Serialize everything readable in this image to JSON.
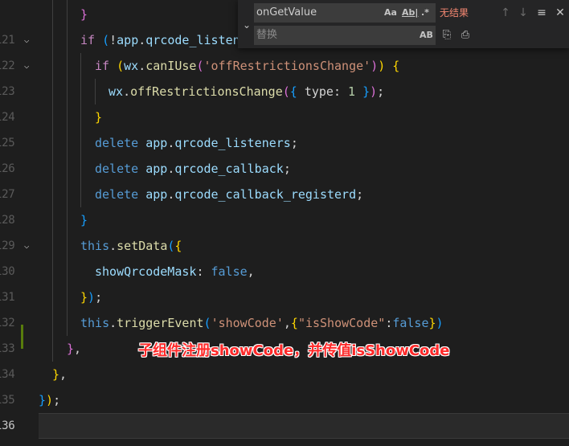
{
  "editor": {
    "lines": [
      {
        "num": "",
        "fold": false,
        "indent": 100,
        "tokens": [
          {
            "t": "}",
            "c": "b2"
          }
        ]
      },
      {
        "num": "121",
        "fold": true,
        "indent": 100,
        "tokens": [
          {
            "t": "if",
            "c": "ctl"
          },
          {
            "t": " ",
            "c": "pl"
          },
          {
            "t": "(",
            "c": "b3"
          },
          {
            "t": "!",
            "c": "pl"
          },
          {
            "t": "app",
            "c": "prop"
          },
          {
            "t": ".",
            "c": "pl"
          },
          {
            "t": "qrcode_listeners",
            "c": "prop"
          }
        ]
      },
      {
        "num": "122",
        "fold": true,
        "indent": 118,
        "tokens": [
          {
            "t": "if",
            "c": "ctl"
          },
          {
            "t": " ",
            "c": "pl"
          },
          {
            "t": "(",
            "c": "b1"
          },
          {
            "t": "wx",
            "c": "prop"
          },
          {
            "t": ".",
            "c": "pl"
          },
          {
            "t": "canIUse",
            "c": "fn"
          },
          {
            "t": "(",
            "c": "b2"
          },
          {
            "t": "'offRestrictionsChange'",
            "c": "str"
          },
          {
            "t": ")",
            "c": "b2"
          },
          {
            "t": ")",
            "c": "b1"
          },
          {
            "t": " ",
            "c": "pl"
          },
          {
            "t": "{",
            "c": "b1"
          }
        ]
      },
      {
        "num": "123",
        "fold": false,
        "indent": 135,
        "tokens": [
          {
            "t": "wx",
            "c": "prop"
          },
          {
            "t": ".",
            "c": "pl"
          },
          {
            "t": "offRestrictionsChange",
            "c": "fn"
          },
          {
            "t": "(",
            "c": "b2"
          },
          {
            "t": "{",
            "c": "b3"
          },
          {
            "t": " type: ",
            "c": "pl"
          },
          {
            "t": "1",
            "c": "num"
          },
          {
            "t": " ",
            "c": "pl"
          },
          {
            "t": "}",
            "c": "b3"
          },
          {
            "t": ")",
            "c": "b2"
          },
          {
            "t": ";",
            "c": "pl"
          }
        ]
      },
      {
        "num": "124",
        "fold": false,
        "indent": 118,
        "tokens": [
          {
            "t": "}",
            "c": "b1"
          }
        ]
      },
      {
        "num": "125",
        "fold": false,
        "indent": 118,
        "tokens": [
          {
            "t": "delete",
            "c": "kw"
          },
          {
            "t": " ",
            "c": "pl"
          },
          {
            "t": "app",
            "c": "prop"
          },
          {
            "t": ".",
            "c": "pl"
          },
          {
            "t": "qrcode_listeners",
            "c": "prop"
          },
          {
            "t": ";",
            "c": "pl"
          }
        ]
      },
      {
        "num": "126",
        "fold": false,
        "indent": 118,
        "tokens": [
          {
            "t": "delete",
            "c": "kw"
          },
          {
            "t": " ",
            "c": "pl"
          },
          {
            "t": "app",
            "c": "prop"
          },
          {
            "t": ".",
            "c": "pl"
          },
          {
            "t": "qrcode_callback",
            "c": "prop"
          },
          {
            "t": ";",
            "c": "pl"
          }
        ]
      },
      {
        "num": "127",
        "fold": false,
        "indent": 118,
        "tokens": [
          {
            "t": "delete",
            "c": "kw"
          },
          {
            "t": " ",
            "c": "pl"
          },
          {
            "t": "app",
            "c": "prop"
          },
          {
            "t": ".",
            "c": "pl"
          },
          {
            "t": "qrcode_callback_registerd",
            "c": "prop"
          },
          {
            "t": ";",
            "c": "pl"
          }
        ]
      },
      {
        "num": "128",
        "fold": false,
        "indent": 100,
        "tokens": [
          {
            "t": "}",
            "c": "b3"
          }
        ]
      },
      {
        "num": "129",
        "fold": true,
        "indent": 100,
        "tokens": [
          {
            "t": "this",
            "c": "kw"
          },
          {
            "t": ".",
            "c": "pl"
          },
          {
            "t": "setData",
            "c": "fn"
          },
          {
            "t": "(",
            "c": "b3"
          },
          {
            "t": "{",
            "c": "b1"
          }
        ]
      },
      {
        "num": "130",
        "fold": false,
        "indent": 118,
        "tokens": [
          {
            "t": "showQrcodeMask",
            "c": "prop"
          },
          {
            "t": ": ",
            "c": "pl"
          },
          {
            "t": "false",
            "c": "kw"
          },
          {
            "t": ",",
            "c": "pl"
          }
        ]
      },
      {
        "num": "131",
        "fold": false,
        "indent": 100,
        "tokens": [
          {
            "t": "}",
            "c": "b1"
          },
          {
            "t": ")",
            "c": "b3"
          },
          {
            "t": ";",
            "c": "pl"
          }
        ]
      },
      {
        "num": "132",
        "fold": false,
        "indent": 100,
        "tokens": [
          {
            "t": "this",
            "c": "kw"
          },
          {
            "t": ".",
            "c": "pl"
          },
          {
            "t": "triggerEvent",
            "c": "fn"
          },
          {
            "t": "(",
            "c": "b3"
          },
          {
            "t": "'showCode'",
            "c": "str"
          },
          {
            "t": ",",
            "c": "pl"
          },
          {
            "t": "{",
            "c": "b1"
          },
          {
            "t": "\"isShowCode\"",
            "c": "str"
          },
          {
            "t": ":",
            "c": "pl"
          },
          {
            "t": "false",
            "c": "kw"
          },
          {
            "t": "}",
            "c": "b1"
          },
          {
            "t": ")",
            "c": "b3"
          }
        ]
      },
      {
        "num": "133",
        "fold": false,
        "indent": 83,
        "tokens": [
          {
            "t": "}",
            "c": "b2"
          },
          {
            "t": ",",
            "c": "pl"
          }
        ]
      },
      {
        "num": "134",
        "fold": false,
        "indent": 65,
        "tokens": [
          {
            "t": "}",
            "c": "b1"
          },
          {
            "t": ",",
            "c": "pl"
          }
        ]
      },
      {
        "num": "135",
        "fold": false,
        "indent": 48,
        "tokens": [
          {
            "t": "}",
            "c": "b3"
          },
          {
            "t": ")",
            "c": "b1"
          },
          {
            "t": ";",
            "c": "pl"
          }
        ]
      },
      {
        "num": "136",
        "fold": false,
        "indent": 48,
        "tokens": []
      }
    ],
    "current_line_index": 16,
    "modified_line_index": 13
  },
  "find_widget": {
    "toggle_icon": "chevron-down",
    "find_value": "onGetValue",
    "match_case_label": "Aa",
    "whole_word_label": "Ab|",
    "regex_label": ".*",
    "result_text": "无结果",
    "replace_placeholder": "替换",
    "preserve_case_label": "AB",
    "prev_icon": "arrow-up",
    "next_icon": "arrow-down",
    "selection_icon": "lines",
    "close_icon": "x"
  },
  "annotation": {
    "text": "子组件注册showCode，并传值isShowCode",
    "color": "#ff2a2a"
  }
}
